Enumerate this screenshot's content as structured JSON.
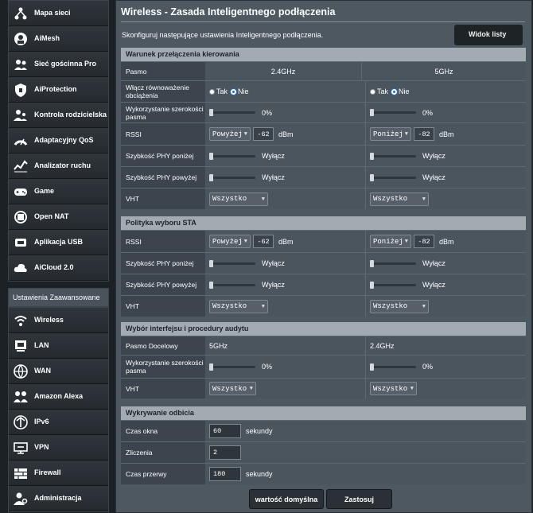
{
  "sidebar": {
    "items_top": [
      {
        "label": "Mapa sieci",
        "icon": "network-map-icon"
      },
      {
        "label": "AiMesh",
        "icon": "aimesh-icon"
      },
      {
        "label": "Sieć gościnna Pro",
        "icon": "guest-network-icon"
      },
      {
        "label": "AiProtection",
        "icon": "shield-icon"
      },
      {
        "label": "Kontrola rodzicielska",
        "icon": "parental-control-icon"
      },
      {
        "label": "Adaptacyjny QoS",
        "icon": "qos-icon"
      },
      {
        "label": "Analizator ruchu",
        "icon": "traffic-analyzer-icon"
      },
      {
        "label": "Game",
        "icon": "game-icon"
      },
      {
        "label": "Open NAT",
        "icon": "open-nat-icon"
      },
      {
        "label": "Aplikacja USB",
        "icon": "usb-icon"
      },
      {
        "label": "AiCloud 2.0",
        "icon": "cloud-icon"
      }
    ],
    "section_label": "Ustawienia Zaawansowane",
    "items_adv": [
      {
        "label": "Wireless",
        "icon": "wireless-icon"
      },
      {
        "label": "LAN",
        "icon": "lan-icon"
      },
      {
        "label": "WAN",
        "icon": "wan-icon"
      },
      {
        "label": "Amazon Alexa",
        "icon": "alexa-icon"
      },
      {
        "label": "IPv6",
        "icon": "ipv6-icon"
      },
      {
        "label": "VPN",
        "icon": "vpn-icon"
      },
      {
        "label": "Firewall",
        "icon": "firewall-icon"
      },
      {
        "label": "Administracja",
        "icon": "administration-icon"
      }
    ]
  },
  "main": {
    "title": "Wireless - Zasada Inteligentnego podłączenia",
    "description": "Skonfiguruj następujące ustawienia Inteligentnego podłączenia.",
    "watermark": "Widok listy",
    "sec1": {
      "header": "Warunek przełączenia kierowania",
      "band_label": "Pasmo",
      "band1": "2.4GHz",
      "band2": "5GHz",
      "enable_label": "Włącz równoważenie obciążenia",
      "yes": "Tak",
      "no": "Nie",
      "bw_label": "Wykorzystanie szerokości pasma",
      "bw1": "0%",
      "bw2": "0%",
      "rssi_label": "RSSI",
      "rssi1_sel": "Powyżej",
      "rssi1_val": "-62",
      "rssi2_sel": "Poniżej",
      "rssi2_val": "-82",
      "dbm": "dBm",
      "phy_below_label": "Szybkość PHY poniżej",
      "phy_above_label": "Szybkość PHY powyżej",
      "off": "Wyłącz",
      "vht_label": "VHT",
      "vht1": "Wszystko",
      "vht2": "Wszystko"
    },
    "sec2": {
      "header": "Polityka wyboru STA",
      "rssi_label": "RSSI",
      "rssi1_sel": "Powyżej",
      "rssi1_val": "-62",
      "rssi2_sel": "Poniżej",
      "rssi2_val": "-82",
      "dbm": "dBm",
      "phy_below_label": "Szybkość PHY poniżej",
      "phy_above_label": "Szybkość PHY powyżej",
      "off": "Wyłącz",
      "vht_label": "VHT",
      "vht1": "Wszystko",
      "vht2": "Wszystko"
    },
    "sec3": {
      "header": "Wybór interfejsu i procedury audytu",
      "target_label": "Pasmo Docelowy",
      "target1": "5GHz",
      "target2": "2.4GHz",
      "bw_label": "Wykorzystanie szerokości pasma",
      "bw1": "0%",
      "bw2": "0%",
      "vht_label": "VHT",
      "vht1": "Wszystko",
      "vht2": "Wszystko"
    },
    "sec4": {
      "header": "Wykrywanie odbicia",
      "window_label": "Czas okna",
      "window_val": "60",
      "window_unit": "sekundy",
      "count_label": "Zliczenia",
      "count_val": "2",
      "dwell_label": "Czas przerwy",
      "dwell_val": "180",
      "dwell_unit": "sekundy"
    },
    "btn_default": "wartość domyślna",
    "btn_apply": "Zastosuj"
  },
  "colors": {
    "accent": "#1f6fe0",
    "header_bar": "#a2abb2",
    "panel": "#4d5861"
  }
}
